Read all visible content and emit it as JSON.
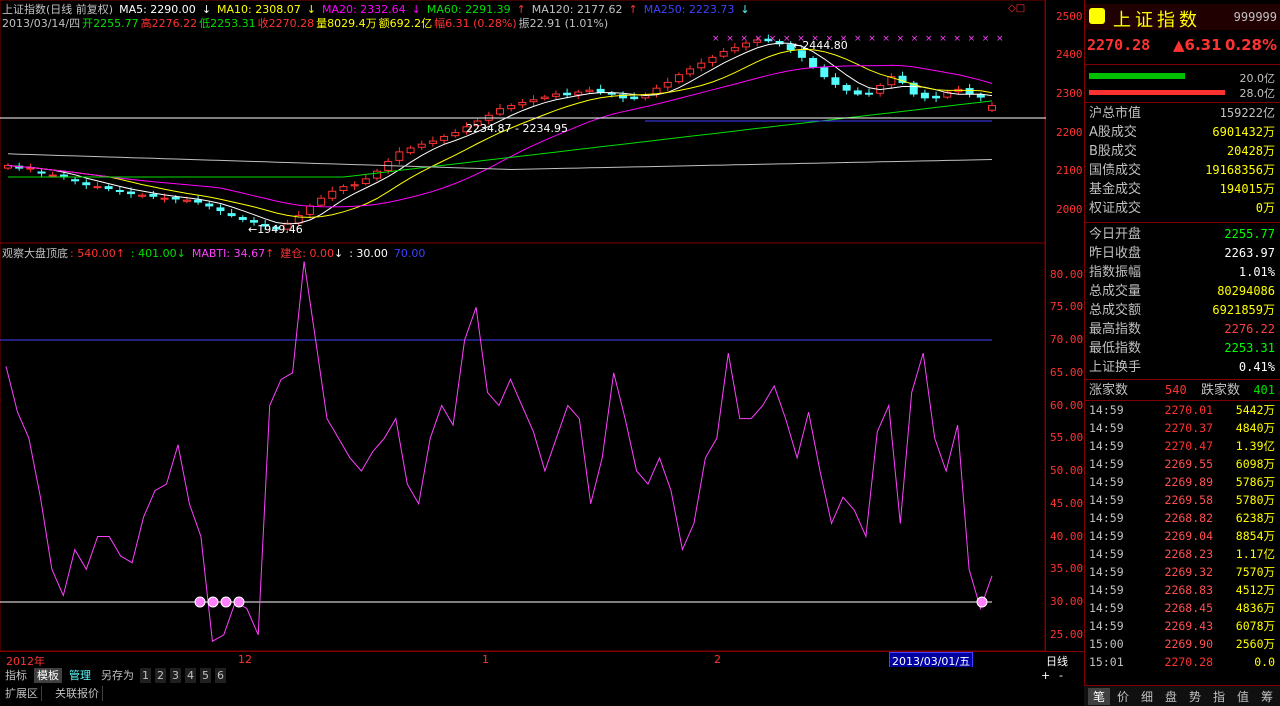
{
  "price_header": {
    "title": "上证指数(日线 前复权)",
    "ma5": "MA5: 2290.00",
    "ma10": "MA10: 2308.07",
    "ma20": "MA20: 2332.64",
    "ma60": "MA60: 2291.39",
    "ma120": "MA120: 2177.62",
    "ma250": "MA250: 2223.73",
    "date": "2013/03/14/四",
    "open": "开2255.77",
    "high": "高2276.22",
    "low": "低2253.31",
    "close": "收2270.28",
    "volume": "量8029.4万",
    "amount": "额692.2亿",
    "change": "幅6.31 (0.28%)",
    "amplitude": "振22.91 (1.01%)"
  },
  "indicator_header": {
    "name": "观察大盘顶底",
    "v1": ": 540.00",
    "v2": ": 401.00",
    "v3": "MABTI: 34.67",
    "v4": "建仓: 0.00",
    "v5": ": 30.00",
    "v6": "70.00"
  },
  "price_axis": [
    "2500",
    "2400",
    "2300",
    "2200",
    "2100",
    "2000"
  ],
  "indicator_axis": [
    "80.00",
    "75.00",
    "70.00",
    "65.00",
    "60.00",
    "55.00",
    "50.00",
    "45.00",
    "40.00",
    "35.00",
    "30.00",
    "25.00"
  ],
  "annotations": {
    "high_label": "2444.80",
    "mid_label": "2234.87 - 2234.95",
    "low_label": "1949.46"
  },
  "time_axis": {
    "labels": [
      "2012年",
      "12",
      "1",
      "2"
    ],
    "cursor_date": "2013/03/01/五",
    "period": "日线"
  },
  "chart_data": {
    "type": "line",
    "title": "观察大盘顶底",
    "series": [
      {
        "name": "MABTI",
        "values": [
          66,
          59,
          55,
          46,
          35,
          31,
          38,
          35,
          40,
          40,
          37,
          36,
          43,
          47,
          48,
          54,
          45,
          40,
          24,
          25,
          30,
          29,
          25,
          60,
          64,
          65,
          82,
          70,
          58,
          55,
          52,
          50,
          53,
          55,
          58,
          48,
          45,
          55,
          60,
          57,
          70,
          75,
          62,
          60,
          64,
          60,
          56,
          50,
          55,
          60,
          58,
          45,
          52,
          65,
          58,
          50,
          48,
          52,
          47,
          38,
          42,
          52,
          55,
          68,
          58,
          58,
          60,
          63,
          58,
          52,
          59,
          50,
          42,
          46,
          44,
          40,
          56,
          60,
          42,
          62,
          68,
          55,
          50,
          57,
          35,
          29,
          34
        ],
        "color": "#ff40ff"
      }
    ],
    "reference_lines": [
      30,
      70
    ],
    "ylim": [
      23,
      83
    ]
  },
  "candles": {
    "closes": [
      2115,
      2108,
      2108,
      2095,
      2090,
      2085,
      2075,
      2065,
      2060,
      2055,
      2048,
      2042,
      2038,
      2035,
      2030,
      2028,
      2025,
      2020,
      2010,
      1998,
      1985,
      1975,
      1968,
      1958,
      1950,
      1965,
      1985,
      2010,
      2030,
      2048,
      2060,
      2065,
      2080,
      2100,
      2125,
      2150,
      2160,
      2170,
      2178,
      2190,
      2200,
      2215,
      2230,
      2245,
      2262,
      2270,
      2278,
      2285,
      2292,
      2300,
      2298,
      2305,
      2310,
      2305,
      2300,
      2290,
      2288,
      2298,
      2315,
      2330,
      2350,
      2365,
      2380,
      2395,
      2410,
      2420,
      2432,
      2440,
      2438,
      2430,
      2415,
      2395,
      2370,
      2345,
      2325,
      2310,
      2300,
      2300,
      2322,
      2345,
      2330,
      2300,
      2290,
      2290,
      2305,
      2312,
      2300,
      2292,
      2270
    ],
    "opens": [
      2108,
      2113,
      2106,
      2098,
      2088,
      2090,
      2078,
      2070,
      2058,
      2060,
      2050,
      2046,
      2035,
      2040,
      2028,
      2032,
      2022,
      2025,
      2015,
      2005,
      1990,
      1980,
      1972,
      1962,
      1955,
      1950,
      1966,
      1988,
      2012,
      2030,
      2050,
      2062,
      2068,
      2082,
      2102,
      2128,
      2148,
      2162,
      2172,
      2180,
      2192,
      2202,
      2218,
      2232,
      2248,
      2262,
      2272,
      2280,
      2288,
      2294,
      2302,
      2298,
      2306,
      2312,
      2302,
      2298,
      2292,
      2290,
      2300,
      2318,
      2332,
      2352,
      2368,
      2382,
      2398,
      2412,
      2422,
      2434,
      2442,
      2436,
      2428,
      2412,
      2392,
      2368,
      2342,
      2322,
      2308,
      2302,
      2302,
      2324,
      2346,
      2328,
      2302,
      2294,
      2292,
      2306,
      2314,
      2298,
      2258
    ]
  },
  "sidebar": {
    "title": "上证指数",
    "code": "999999",
    "price": "2270.28",
    "change": "▲6.31",
    "pct": "0.28%",
    "bar1_label": "20.0亿",
    "bar2_label": "28.0亿",
    "stats": [
      {
        "label": "沪总市值",
        "value": "159222亿",
        "color": "#c0c0c0"
      },
      {
        "label": "A股成交",
        "value": "6901432万",
        "color": "#ffff00"
      },
      {
        "label": "B股成交",
        "value": "20428万",
        "color": "#ffff00"
      },
      {
        "label": "国债成交",
        "value": "19168356万",
        "color": "#ffff00"
      },
      {
        "label": "基金成交",
        "value": "194015万",
        "color": "#ffff00"
      },
      {
        "label": "权证成交",
        "value": "0万",
        "color": "#ffff00"
      }
    ],
    "stats2": [
      {
        "label": "今日开盘",
        "value": "2255.77",
        "color": "#00ff00"
      },
      {
        "label": "昨日收盘",
        "value": "2263.97",
        "color": "#ffffff"
      },
      {
        "label": "指数振幅",
        "value": "1.01%",
        "color": "#ffffff"
      },
      {
        "label": "总成交量",
        "value": "80294086",
        "color": "#ffff00"
      },
      {
        "label": "总成交额",
        "value": "6921859万",
        "color": "#ffff00"
      },
      {
        "label": "最高指数",
        "value": "2276.22",
        "color": "#ff4040"
      },
      {
        "label": "最低指数",
        "value": "2253.31",
        "color": "#00ff00"
      },
      {
        "label": "上证换手",
        "value": "0.41%",
        "color": "#ffffff"
      }
    ],
    "up_label": "涨家数",
    "up_value": "540",
    "down_label": "跌家数",
    "down_value": "401",
    "ticks": [
      {
        "t": "14:59",
        "p": "2270.01",
        "v": "5442万"
      },
      {
        "t": "14:59",
        "p": "2270.37",
        "v": "4840万"
      },
      {
        "t": "14:59",
        "p": "2270.47",
        "v": "1.39亿"
      },
      {
        "t": "14:59",
        "p": "2269.55",
        "v": "6098万"
      },
      {
        "t": "14:59",
        "p": "2269.89",
        "v": "5786万"
      },
      {
        "t": "14:59",
        "p": "2269.58",
        "v": "5780万"
      },
      {
        "t": "14:59",
        "p": "2268.82",
        "v": "6238万"
      },
      {
        "t": "14:59",
        "p": "2269.04",
        "v": "8854万"
      },
      {
        "t": "14:59",
        "p": "2268.23",
        "v": "1.17亿"
      },
      {
        "t": "14:59",
        "p": "2269.32",
        "v": "7570万"
      },
      {
        "t": "14:59",
        "p": "2268.83",
        "v": "4512万"
      },
      {
        "t": "14:59",
        "p": "2268.45",
        "v": "4836万"
      },
      {
        "t": "14:59",
        "p": "2269.43",
        "v": "6078万"
      },
      {
        "t": "15:00",
        "p": "2269.90",
        "v": "2560万"
      },
      {
        "t": "15:01",
        "p": "2270.28",
        "v": "0.0"
      }
    ],
    "tabs": [
      "笔",
      "价",
      "细",
      "盘",
      "势",
      "指",
      "值",
      "筹"
    ]
  },
  "bottom_tabs": [
    "指标",
    "模板",
    "管理",
    "另存为",
    "1",
    "2",
    "3",
    "4",
    "5",
    "6"
  ],
  "bottom_tabs2": [
    "扩展区",
    "关联报价"
  ],
  "colors": {
    "up": "#ff3232",
    "down": "#54fcfc",
    "axis": "#800000",
    "ma_white": "#ffffff",
    "ma_yellow": "#ffff00",
    "ma_magenta": "#ff00ff",
    "ma_green": "#00e000"
  }
}
